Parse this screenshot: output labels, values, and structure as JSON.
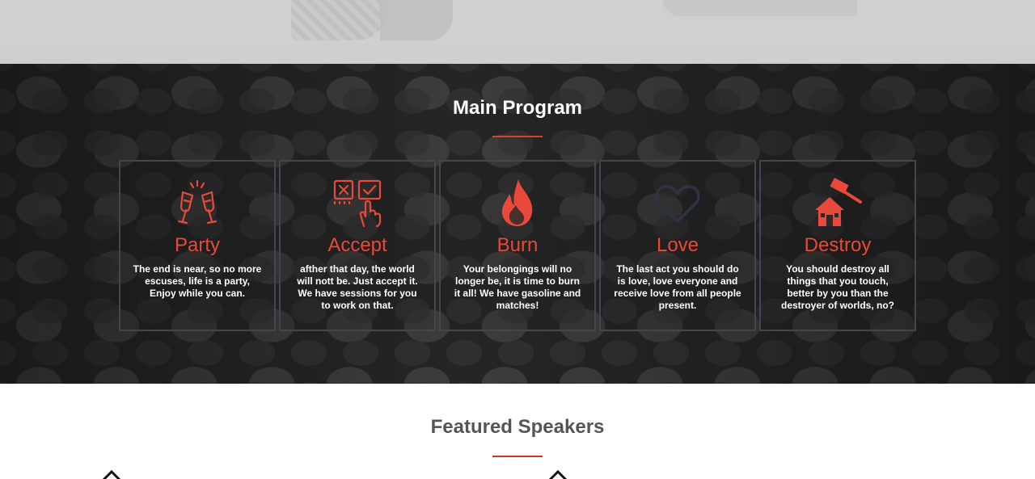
{
  "program": {
    "title": "Main Program",
    "accent_color": "#e8493a",
    "cards": [
      {
        "icon": "champagne-toast-icon",
        "title": "Party",
        "text": "The end is near, so no more escuses, life is a party, Enjoy while you can."
      },
      {
        "icon": "checkbox-tap-icon",
        "title": "Accept",
        "text": "afther that day, the world will nott be. Just accept it. We have sessions for you to work on that."
      },
      {
        "icon": "flame-icon",
        "title": "Burn",
        "text": "Your belongings will no longer be, it is time to burn it all! We have gasoline and matches!"
      },
      {
        "icon": "heart-icon",
        "title": "Love",
        "text": "The last act you should do is love, love everyone and receive love from all people present."
      },
      {
        "icon": "hammer-house-icon",
        "title": "Destroy",
        "text": "You should destroy all things that you touch, better by you than the destroyer of worlds, no?"
      }
    ]
  },
  "speakers": {
    "title": "Featured Speakers"
  }
}
